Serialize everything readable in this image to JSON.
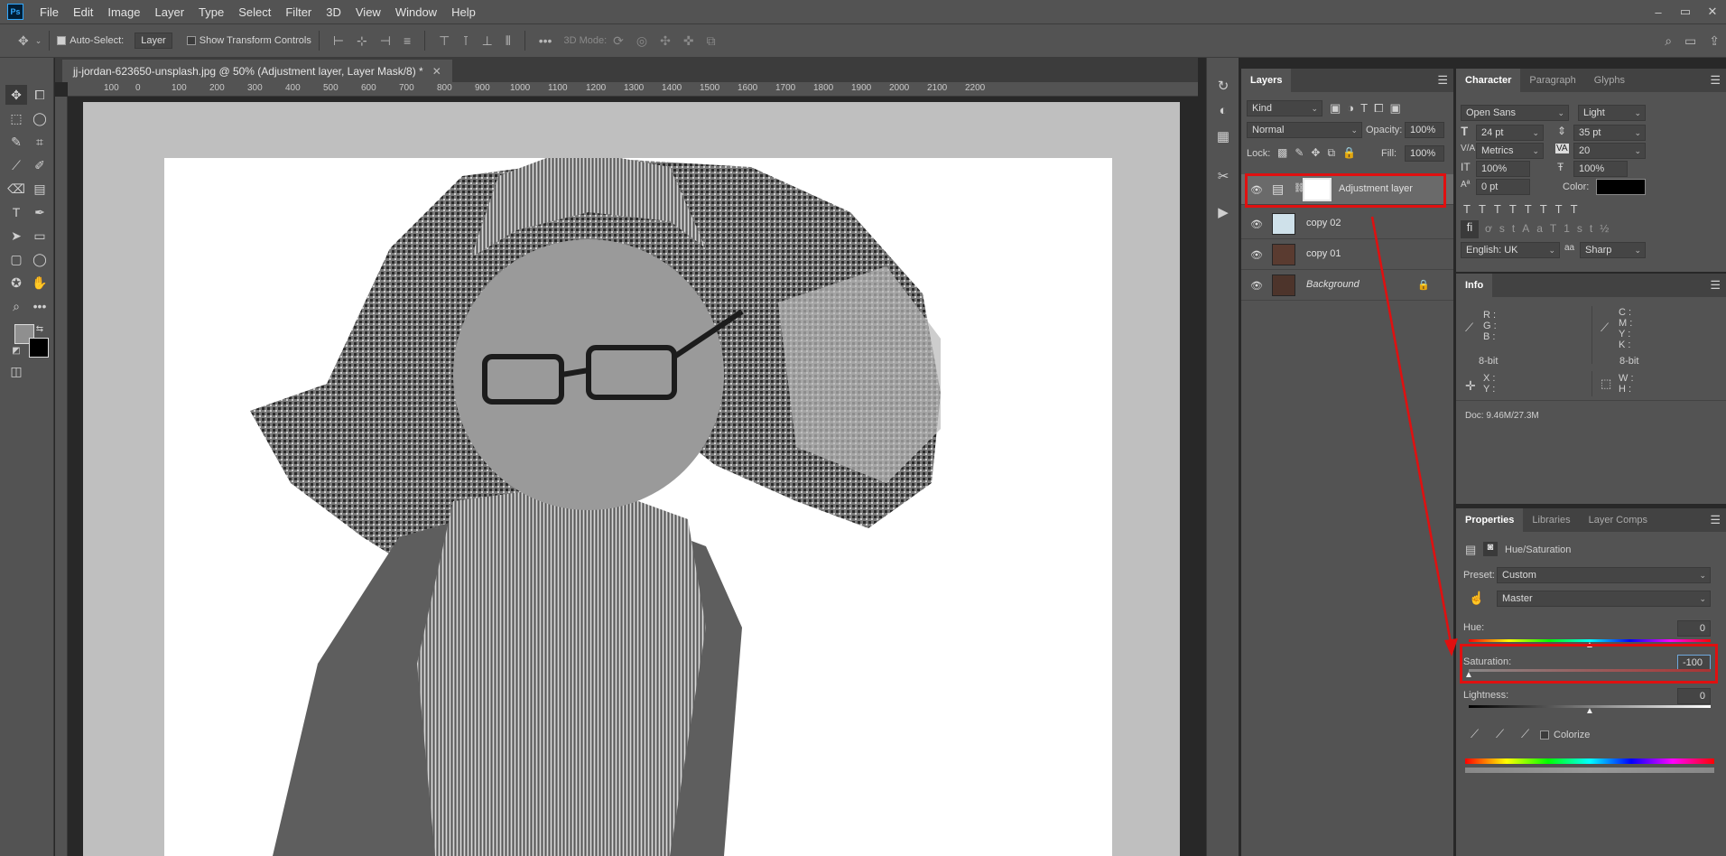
{
  "menu": [
    "File",
    "Edit",
    "Image",
    "Layer",
    "Type",
    "Select",
    "Filter",
    "3D",
    "View",
    "Window",
    "Help"
  ],
  "app_logo": "Ps",
  "window_controls": [
    "–",
    "▭",
    "✕"
  ],
  "options": {
    "auto_select_label": "Auto-Select:",
    "auto_select_target": "Layer",
    "show_transform_label": "Show Transform Controls",
    "mode_3d_label": "3D Mode:"
  },
  "document": {
    "tab_title": "jj-jordan-623650-unsplash.jpg @ 50% (Adjustment layer, Layer Mask/8) *",
    "ruler_ticks": [
      "100",
      "0",
      "100",
      "200",
      "300",
      "400",
      "500",
      "600",
      "700",
      "800",
      "900",
      "1000",
      "1100",
      "1200",
      "1300",
      "1400",
      "1500",
      "1600",
      "1700",
      "1800",
      "1900",
      "2000",
      "2100",
      "2200"
    ]
  },
  "layers": {
    "tab": "Layers",
    "filter_kind": "Kind",
    "blend_mode": "Normal",
    "opacity_label": "Opacity:",
    "opacity_value": "100%",
    "lock_label": "Lock:",
    "fill_label": "Fill:",
    "fill_value": "100%",
    "items": [
      {
        "name": "Adjustment layer"
      },
      {
        "name": "copy 02"
      },
      {
        "name": "copy 01"
      },
      {
        "name": "Background"
      }
    ]
  },
  "character": {
    "tabs": [
      "Character",
      "Paragraph",
      "Glyphs"
    ],
    "font_family": "Open Sans",
    "font_style": "Light",
    "font_size": "24 pt",
    "leading": "35 pt",
    "kerning": "Metrics",
    "tracking": "20",
    "vscale": "100%",
    "hscale": "100%",
    "baseline": "0 pt",
    "color_label": "Color:",
    "language": "English: UK",
    "antialias_prefix": "aa",
    "antialias": "Sharp",
    "colors": {
      "text_color": "#000000"
    }
  },
  "info": {
    "tab": "Info",
    "rgb": [
      "R :",
      "G :",
      "B :"
    ],
    "cmyk": [
      "C :",
      "M :",
      "Y :",
      "K :"
    ],
    "bit_left": "8-bit",
    "bit_right": "8-bit",
    "xy": [
      "X :",
      "Y :"
    ],
    "wh": [
      "W :",
      "H :"
    ],
    "doc": "Doc: 9.46M/27.3M"
  },
  "properties": {
    "tabs": [
      "Properties",
      "Libraries",
      "Layer Comps"
    ],
    "title": "Hue/Saturation",
    "preset_label": "Preset:",
    "preset_value": "Custom",
    "channel": "Master",
    "hue_label": "Hue:",
    "hue_value": "0",
    "saturation_label": "Saturation:",
    "saturation_value": "-100",
    "lightness_label": "Lightness:",
    "lightness_value": "0",
    "colorize_label": "Colorize",
    "hue_slider_level": 0.5,
    "saturation_slider_level": 0.0,
    "lightness_slider_level": 0.5
  }
}
